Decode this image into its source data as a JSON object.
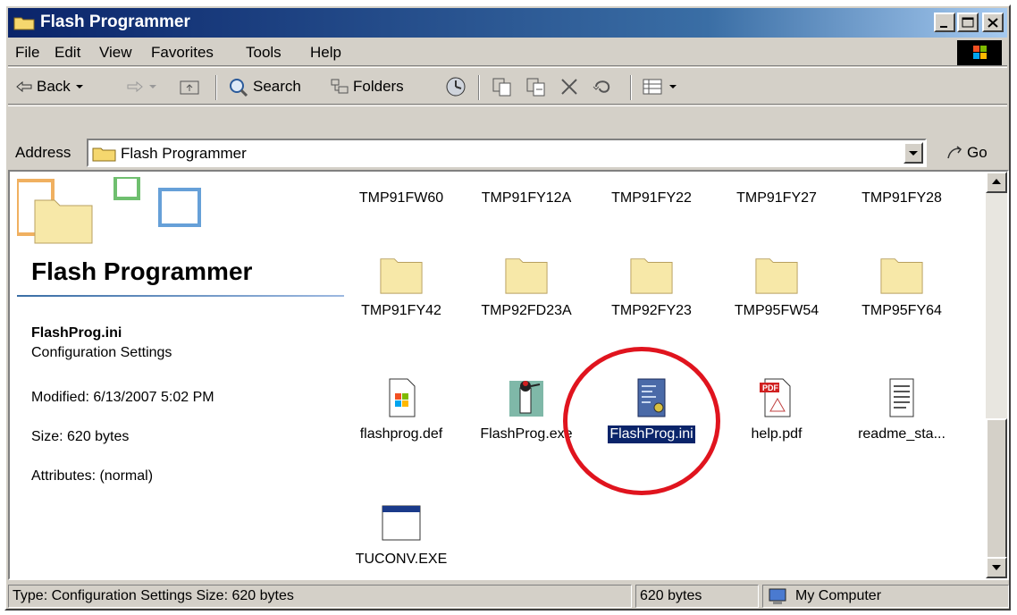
{
  "window": {
    "title": "Flash Programmer"
  },
  "menu": [
    {
      "label": "File"
    },
    {
      "label": "Edit"
    },
    {
      "label": "View"
    },
    {
      "label": "Favorites"
    },
    {
      "label": "Tools"
    },
    {
      "label": "Help"
    }
  ],
  "toolbar": {
    "back_label": "Back",
    "search_label": "Search",
    "folders_label": "Folders"
  },
  "address": {
    "label": "Address",
    "value": "Flash Programmer",
    "go_label": "Go"
  },
  "left_pane": {
    "banner_title": "Flash Programmer",
    "file_name": "FlashProg.ini",
    "file_type": "Configuration Settings",
    "modified": "Modified: 6/13/2007 5:02 PM",
    "size": "Size: 620 bytes",
    "attributes": "Attributes: (normal)"
  },
  "top_row_labels": [
    "TMP91FW60",
    "TMP91FY12A",
    "TMP91FY22",
    "TMP91FY27",
    "TMP91FY28"
  ],
  "folders": [
    "TMP91FY42",
    "TMP92FD23A",
    "TMP92FY23",
    "TMP95FW54",
    "TMP95FY64"
  ],
  "files": [
    {
      "name": "flashprog.def",
      "icon": "def-file-icon"
    },
    {
      "name": "FlashProg.exe",
      "icon": "woodpecker-exe-icon"
    },
    {
      "name": "FlashProg.ini",
      "icon": "ini-settings-icon",
      "selected": true
    },
    {
      "name": "help.pdf",
      "icon": "pdf-icon"
    },
    {
      "name": "readme_sta...",
      "icon": "text-document-icon"
    }
  ],
  "last_file": {
    "name": "TUCONV.EXE",
    "icon": "exe-window-icon"
  },
  "status": {
    "left": "Type: Configuration Settings Size: 620 bytes",
    "middle": "620 bytes",
    "right": "My Computer"
  },
  "colors": {
    "title_gradient_start": "#0a246a",
    "selection": "#0a246a",
    "annotation_circle": "#e0141e",
    "folder_yellow": "#f7e8a8"
  }
}
